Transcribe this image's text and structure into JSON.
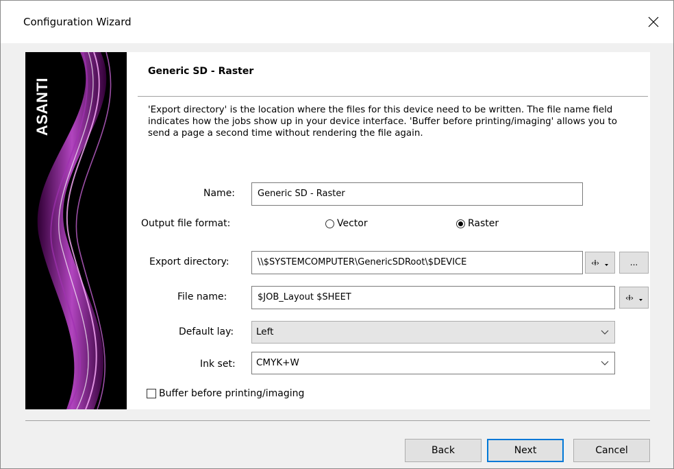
{
  "window": {
    "title": "Configuration Wizard",
    "close_glyph": "✕"
  },
  "banner": {
    "brand": "ASANTI",
    "accent_color": "#c040d0"
  },
  "page": {
    "heading": "Generic SD - Raster",
    "description": "'Export directory' is the location where the files for this device need to be written. The file name field indicates how the jobs show up in your device interface. 'Buffer before printing/imaging' allows you to send a page a second time without rendering the file again."
  },
  "form": {
    "name": {
      "label": "Name:",
      "value": "Generic SD - Raster"
    },
    "output_format": {
      "label": "Output file format:",
      "options": [
        "Vector",
        "Raster"
      ],
      "selected": "Raster"
    },
    "export_directory": {
      "label": "Export directory:",
      "value": "\\\\$SYSTEMCOMPUTER\\GenericSDRoot\\$DEVICE",
      "browse_label": "..."
    },
    "file_name": {
      "label": "File name:",
      "value": "$JOB_Layout $SHEET"
    },
    "default_lay": {
      "label": "Default lay:",
      "value": "Left"
    },
    "ink_set": {
      "label": "Ink set:",
      "value": "CMYK+W"
    },
    "buffer": {
      "label": "Buffer before printing/imaging",
      "checked": false
    }
  },
  "buttons": {
    "back": "Back",
    "next": "Next",
    "cancel": "Cancel"
  }
}
